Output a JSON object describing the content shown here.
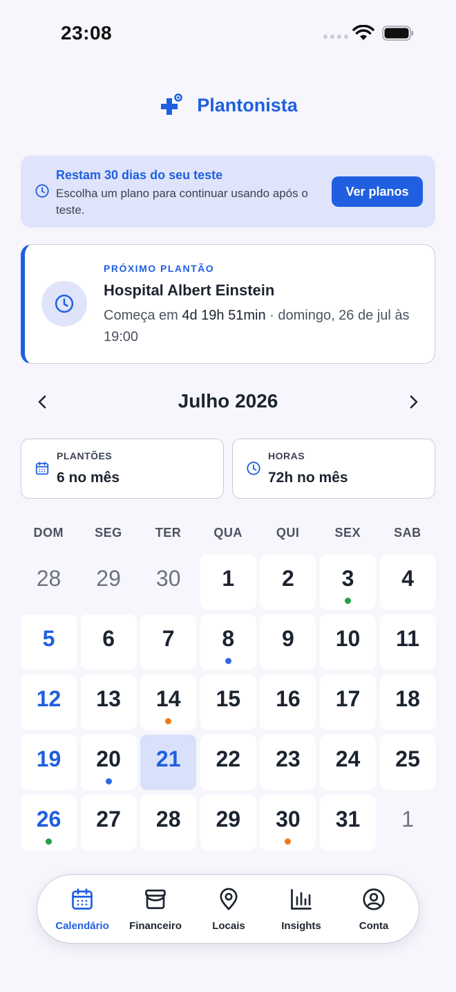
{
  "status_bar": {
    "time": "23:08"
  },
  "app": {
    "title": "Plantonista",
    "brand_color": "#1f5fe0"
  },
  "trial": {
    "title": "Restam 30 dias do seu teste",
    "description": "Escolha um plano para continuar usando após o teste.",
    "button": "Ver planos"
  },
  "next_shift": {
    "label": "PRÓXIMO PLANTÃO",
    "hospital": "Hospital Albert Einstein",
    "prefix": "Começa em ",
    "countdown": "4d 19h 51min",
    "suffix": " · domingo, 26 de jul às 19:00"
  },
  "calendar": {
    "month": "Julho 2026",
    "weekdays": [
      "DOM",
      "SEG",
      "TER",
      "QUA",
      "QUI",
      "SEX",
      "SAB"
    ],
    "days": [
      {
        "n": "28",
        "other": true
      },
      {
        "n": "29",
        "other": true
      },
      {
        "n": "30",
        "other": true
      },
      {
        "n": "1"
      },
      {
        "n": "2"
      },
      {
        "n": "3",
        "dot": "#22a04b"
      },
      {
        "n": "4"
      },
      {
        "n": "5"
      },
      {
        "n": "6"
      },
      {
        "n": "7"
      },
      {
        "n": "8",
        "dot": "#2f6ae6"
      },
      {
        "n": "9"
      },
      {
        "n": "10"
      },
      {
        "n": "11"
      },
      {
        "n": "12"
      },
      {
        "n": "13"
      },
      {
        "n": "14",
        "dot": "#f07a1a"
      },
      {
        "n": "15"
      },
      {
        "n": "16"
      },
      {
        "n": "17"
      },
      {
        "n": "18"
      },
      {
        "n": "19"
      },
      {
        "n": "20",
        "dot": "#2f6ae6"
      },
      {
        "n": "21",
        "today": true
      },
      {
        "n": "22"
      },
      {
        "n": "23"
      },
      {
        "n": "24"
      },
      {
        "n": "25"
      },
      {
        "n": "26",
        "dot": "#22a04b"
      },
      {
        "n": "27"
      },
      {
        "n": "28"
      },
      {
        "n": "29"
      },
      {
        "n": "30",
        "dot": "#f07a1a"
      },
      {
        "n": "31"
      },
      {
        "n": "1",
        "other": true
      }
    ]
  },
  "stats": {
    "shifts": {
      "label": "PLANTÕES",
      "value": "6 no mês"
    },
    "hours": {
      "label": "HORAS",
      "value": "72h no mês"
    }
  },
  "nav": {
    "items": [
      {
        "label": "Calendário",
        "icon": "calendar-icon",
        "active": true
      },
      {
        "label": "Financeiro",
        "icon": "wallet-icon"
      },
      {
        "label": "Locais",
        "icon": "map-pin-icon"
      },
      {
        "label": "Insights",
        "icon": "bar-chart-icon"
      },
      {
        "label": "Conta",
        "icon": "user-circle-icon"
      }
    ]
  }
}
